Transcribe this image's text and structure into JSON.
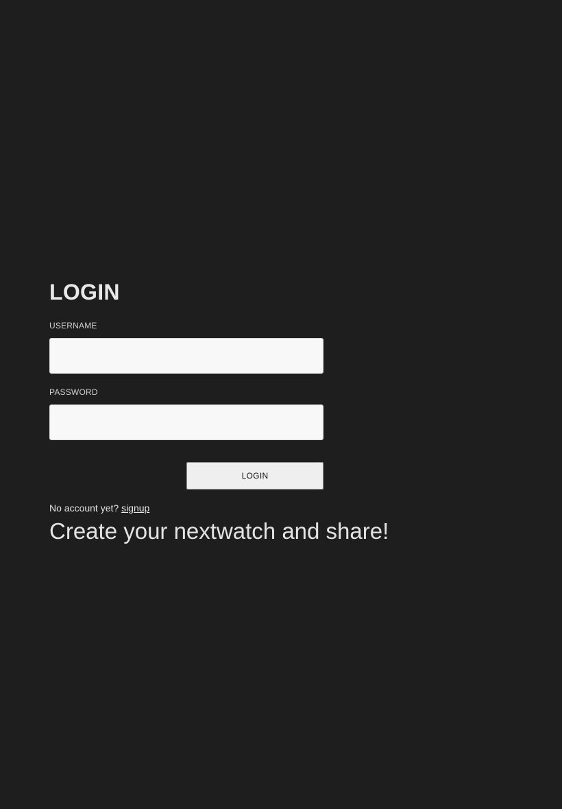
{
  "login": {
    "title": "LOGIN",
    "username_label": "USERNAME",
    "username_value": "",
    "password_label": "PASSWORD",
    "password_value": "",
    "button_label": "LOGIN"
  },
  "signup": {
    "prompt": "No account yet?",
    "link_label": "signup"
  },
  "tagline": "Create your nextwatch and share!",
  "colors": {
    "background": "#1e1e1e",
    "input_background": "#f8f8f8",
    "button_background": "#efefef",
    "text": "#e6e6e6"
  }
}
